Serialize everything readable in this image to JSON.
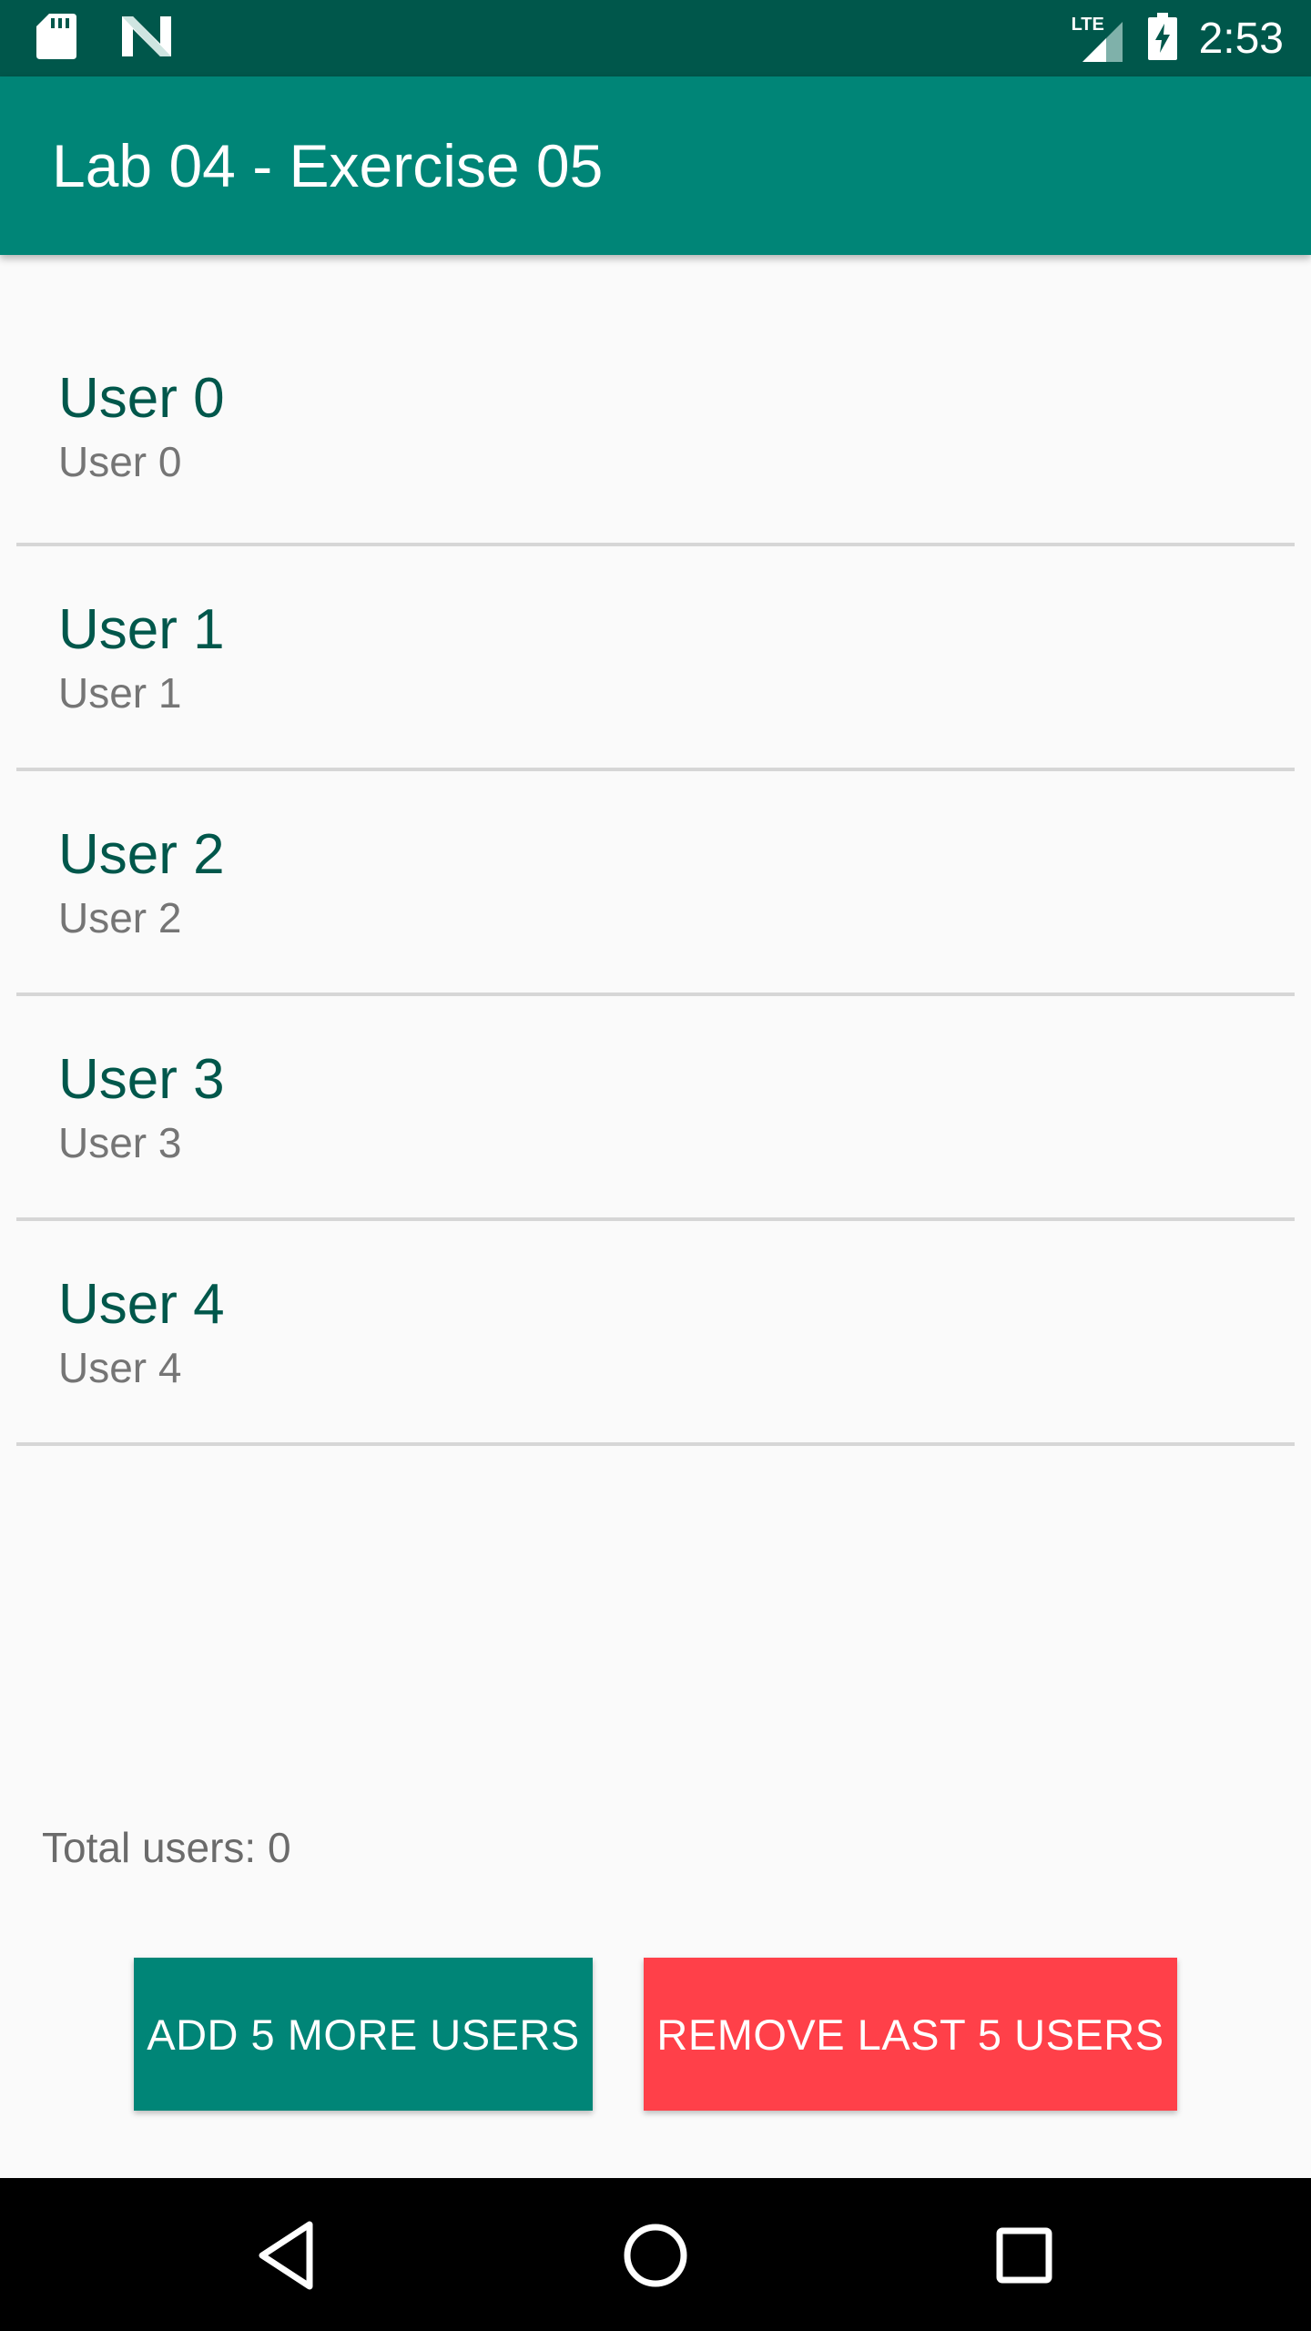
{
  "status_bar": {
    "time": "2:53",
    "network_label": "LTE",
    "icons": [
      "sd-card-icon",
      "n-logo-icon",
      "lte-signal-icon",
      "battery-charging-icon"
    ]
  },
  "app_bar": {
    "title": "Lab 04 - Exercise 05"
  },
  "users": [
    {
      "name": "User 0",
      "subtitle": "User 0"
    },
    {
      "name": "User 1",
      "subtitle": "User 1"
    },
    {
      "name": "User 2",
      "subtitle": "User 2"
    },
    {
      "name": "User 3",
      "subtitle": "User 3"
    },
    {
      "name": "User 4",
      "subtitle": "User 4"
    }
  ],
  "total_label": "Total users: 0",
  "buttons": {
    "add_label": "ADD 5 MORE USERS",
    "remove_label": "REMOVE LAST 5 USERS"
  },
  "nav_bar": {
    "icons": [
      "back-icon",
      "home-icon",
      "recents-icon"
    ]
  },
  "colors": {
    "status_bar": "#00574b",
    "primary": "#008577",
    "remove_button": "#ff4049",
    "user_name_text": "#00574b",
    "background": "#fafafa"
  }
}
